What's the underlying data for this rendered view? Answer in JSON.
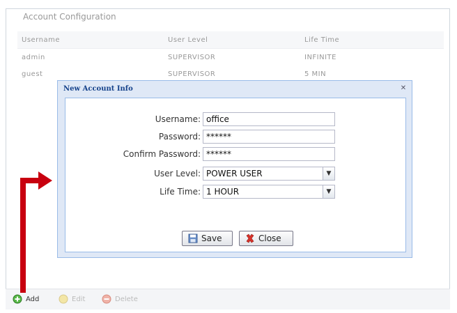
{
  "panel": {
    "legend": "Account Configuration"
  },
  "table": {
    "headers": [
      "Username",
      "User Level",
      "Life Time"
    ],
    "rows": [
      [
        "admin",
        "SUPERVISOR",
        "INFINITE"
      ],
      [
        "guest",
        "SUPERVISOR",
        "5 MIN"
      ]
    ]
  },
  "dialog": {
    "title": "New Account Info",
    "close_icon": "close-icon",
    "fields": {
      "username": {
        "label": "Username:",
        "value": "office"
      },
      "password": {
        "label": "Password:",
        "value": "******"
      },
      "confirm_password": {
        "label": "Confirm Password:",
        "value": "******"
      },
      "user_level": {
        "label": "User Level:",
        "value": "POWER USER"
      },
      "life_time": {
        "label": "Life Time:",
        "value": "1 HOUR"
      }
    },
    "save_label": "Save",
    "close_label": "Close"
  },
  "toolbar": {
    "add_label": "Add",
    "edit_label": "Edit",
    "delete_label": "Delete"
  },
  "colors": {
    "annotation_arrow": "#c8000f",
    "dialog_background": "#dfe8f6",
    "dialog_title": "#15428b"
  }
}
